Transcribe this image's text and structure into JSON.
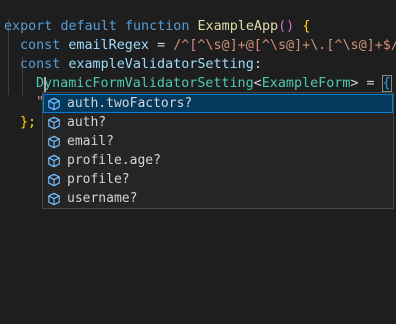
{
  "code": {
    "line1": {
      "export_kw": "export",
      "default_kw": "default",
      "function_kw": "function",
      "fn_name": "ExampleApp",
      "parens": "()",
      "open_brace": "{"
    },
    "line2": {
      "const_kw": "const",
      "var_name": "emailRegex",
      "equals": "=",
      "regex": "/^[^\\s@]+@[^\\s@]+\\.[^\\s@]+$/;"
    },
    "line3": {
      "const_kw": "const",
      "var_name": "exampleValidatorSetting",
      "colon": ":"
    },
    "line4": {
      "type_name": "DynamicFormValidatorSetting",
      "lt": "<",
      "generic": "ExampleForm",
      "gt": ">",
      "equals": "=",
      "open_brace": "{"
    },
    "line5": {
      "quotes": "\"\""
    },
    "line7": {
      "close": "};"
    }
  },
  "suggestions": {
    "items": [
      {
        "label": "auth.twoFactors?",
        "icon": "cube-icon",
        "selected": true
      },
      {
        "label": "auth?",
        "icon": "cube-icon",
        "selected": false
      },
      {
        "label": "email?",
        "icon": "cube-icon",
        "selected": false
      },
      {
        "label": "profile.age?",
        "icon": "cube-icon",
        "selected": false
      },
      {
        "label": "profile?",
        "icon": "cube-icon",
        "selected": false
      },
      {
        "label": "username?",
        "icon": "cube-icon",
        "selected": false
      }
    ]
  },
  "colors": {
    "background": "#1e1e1e",
    "keyword": "#569cd6",
    "function": "#dcdcaa",
    "variable": "#9cdcfe",
    "type": "#4ec9b0",
    "string": "#ce9178",
    "suggest_bg": "#252526",
    "suggest_selected": "#04395e",
    "suggest_border": "#007fd4"
  }
}
